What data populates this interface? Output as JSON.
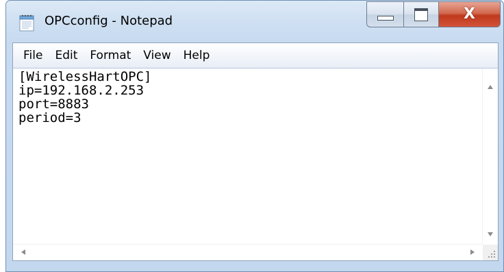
{
  "window": {
    "title": "OPCconfig - Notepad",
    "icons": {
      "app": "notepad-icon",
      "minimize": "minimize-icon",
      "maximize": "maximize-icon",
      "close": "close-icon"
    },
    "close_glyph": "X",
    "colors": {
      "close_button": "#c7472c",
      "frame": "#c7daf0"
    }
  },
  "menu": {
    "items": [
      "File",
      "Edit",
      "Format",
      "View",
      "Help"
    ]
  },
  "editor": {
    "lines": [
      "[WirelessHartOPC]",
      "ip=192.168.2.253",
      "port=8883",
      "period=3"
    ]
  },
  "scrollbars": {
    "vertical_up": "scroll-up-arrow-icon",
    "vertical_down": "scroll-down-arrow-icon",
    "horizontal_left": "scroll-left-arrow-icon",
    "horizontal_right": "scroll-right-arrow-icon",
    "size_grip": "size-grip-icon"
  }
}
